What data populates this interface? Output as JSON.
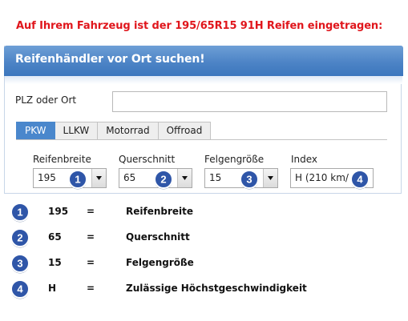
{
  "headline": "Auf Ihrem Fahrzeug ist der 195/65R15 91H Reifen eingetragen:",
  "panel": {
    "title": "Reifenhändler vor Ort suchen!",
    "plz_label": "PLZ oder Ort",
    "plz_value": "",
    "plz_placeholder": ""
  },
  "tabs": [
    {
      "label": "PKW",
      "active": true
    },
    {
      "label": "LLKW",
      "active": false
    },
    {
      "label": "Motorrad",
      "active": false
    },
    {
      "label": "Offroad",
      "active": false
    }
  ],
  "fields": [
    {
      "label": "Reifenbreite",
      "value": "195",
      "badge": "1"
    },
    {
      "label": "Querschnitt",
      "value": "65",
      "badge": "2"
    },
    {
      "label": "Felgengröße",
      "value": "15",
      "badge": "3"
    },
    {
      "label": "Index",
      "value": "H (210 km/",
      "badge": "4"
    }
  ],
  "legend": [
    {
      "badge": "1",
      "code": "195",
      "eq": "=",
      "desc": "Reifenbreite"
    },
    {
      "badge": "2",
      "code": "65",
      "eq": "=",
      "desc": "Querschnitt"
    },
    {
      "badge": "3",
      "code": "15",
      "eq": "=",
      "desc": "Felgengröße"
    },
    {
      "badge": "4",
      "code": "H",
      "eq": "=",
      "desc": "Zulässige Höchstgeschwindigkeit"
    }
  ],
  "colors": {
    "headline": "#e0161c",
    "header": "#4d84c6",
    "active_tab": "#4a87cc",
    "badge": "#2f56a8"
  }
}
